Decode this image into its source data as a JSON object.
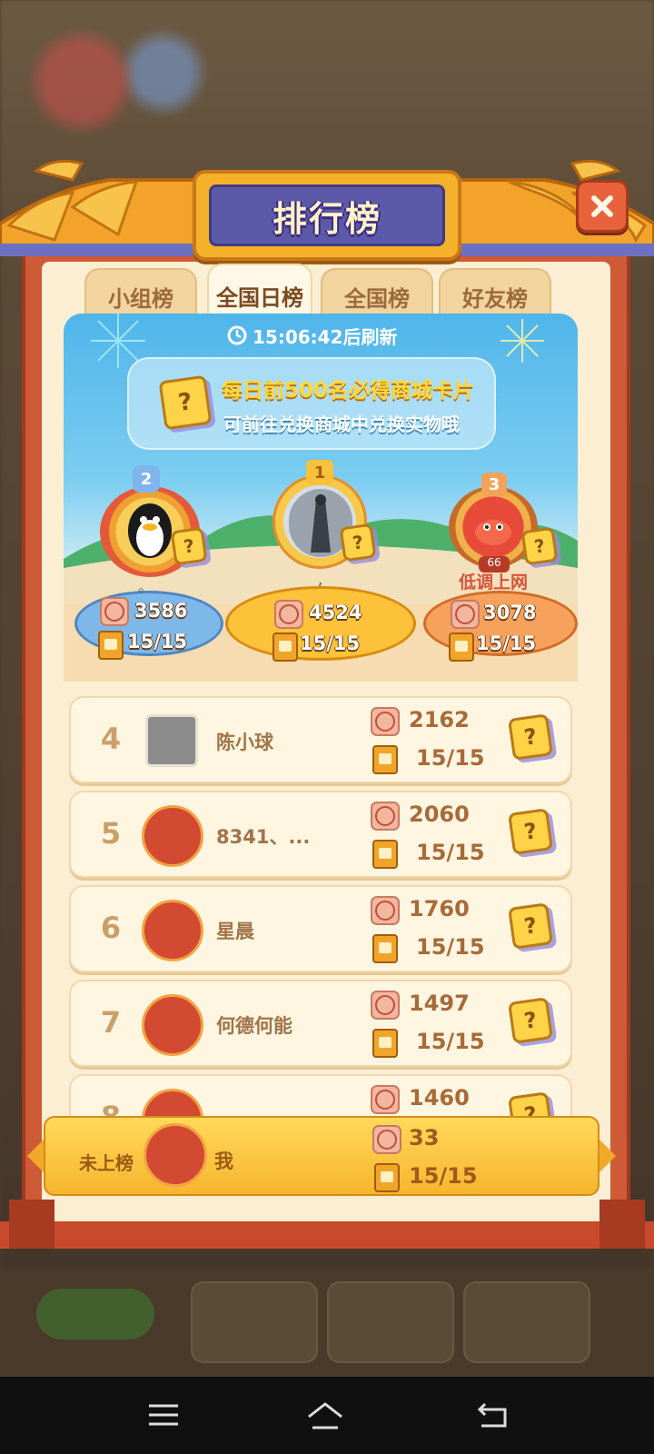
{
  "title": "排行榜",
  "tabs": [
    {
      "label": "小组榜",
      "active": false
    },
    {
      "label": "全国日榜",
      "active": true
    },
    {
      "label": "全国榜",
      "active": false
    },
    {
      "label": "好友榜",
      "active": false
    }
  ],
  "refresh_text": "15:06:42后刷新",
  "banner": {
    "line1": "每日前500名必得商城卡片",
    "line2": "可前往兑换商城中兑换实物哦"
  },
  "podium": {
    "first": {
      "rank": "1",
      "score": "4524",
      "books": "15/15",
      "name": ","
    },
    "second": {
      "rank": "2",
      "score": "3586",
      "books": "15/15",
      "name": "。"
    },
    "third": {
      "rank": "3",
      "score": "3078",
      "books": "15/15",
      "name": "低调上网",
      "level": "66"
    }
  },
  "rows": [
    {
      "rank": "4",
      "name": "陈小球",
      "score": "2162",
      "books": "15/15"
    },
    {
      "rank": "5",
      "name": "8341、...",
      "score": "2060",
      "books": "15/15"
    },
    {
      "rank": "6",
      "name": "星晨",
      "score": "1760",
      "books": "15/15"
    },
    {
      "rank": "7",
      "name": "何德何能",
      "score": "1497",
      "books": "15/15"
    },
    {
      "rank": "8",
      "name": "",
      "score": "1460",
      "books": ""
    }
  ],
  "self": {
    "status": "未上榜",
    "name": "我",
    "score": "33",
    "books": "15/15"
  },
  "card_symbol": "?",
  "colors": {
    "accent_orange": "#f6b12a",
    "frame_red": "#cf5a36",
    "title_purple": "#5c5aa8"
  }
}
